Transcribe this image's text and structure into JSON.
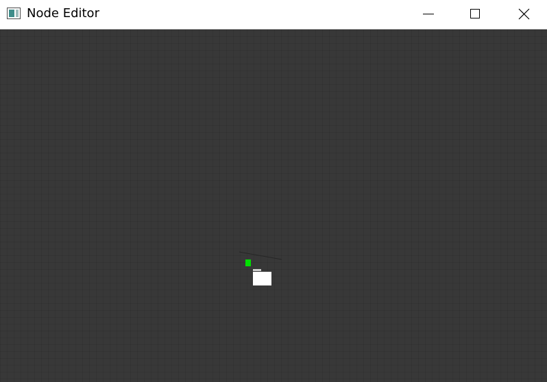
{
  "window": {
    "title": "Node Editor",
    "icon": "node-editor-app-icon",
    "controls": {
      "minimize_icon": "minimize-icon",
      "maximize_icon": "maximize-icon",
      "close_icon": "close-icon"
    }
  },
  "canvas": {
    "background_color": "#383838",
    "grid": true,
    "node": {
      "pin_color": "#00e000",
      "body_color": "#ffffff"
    }
  }
}
